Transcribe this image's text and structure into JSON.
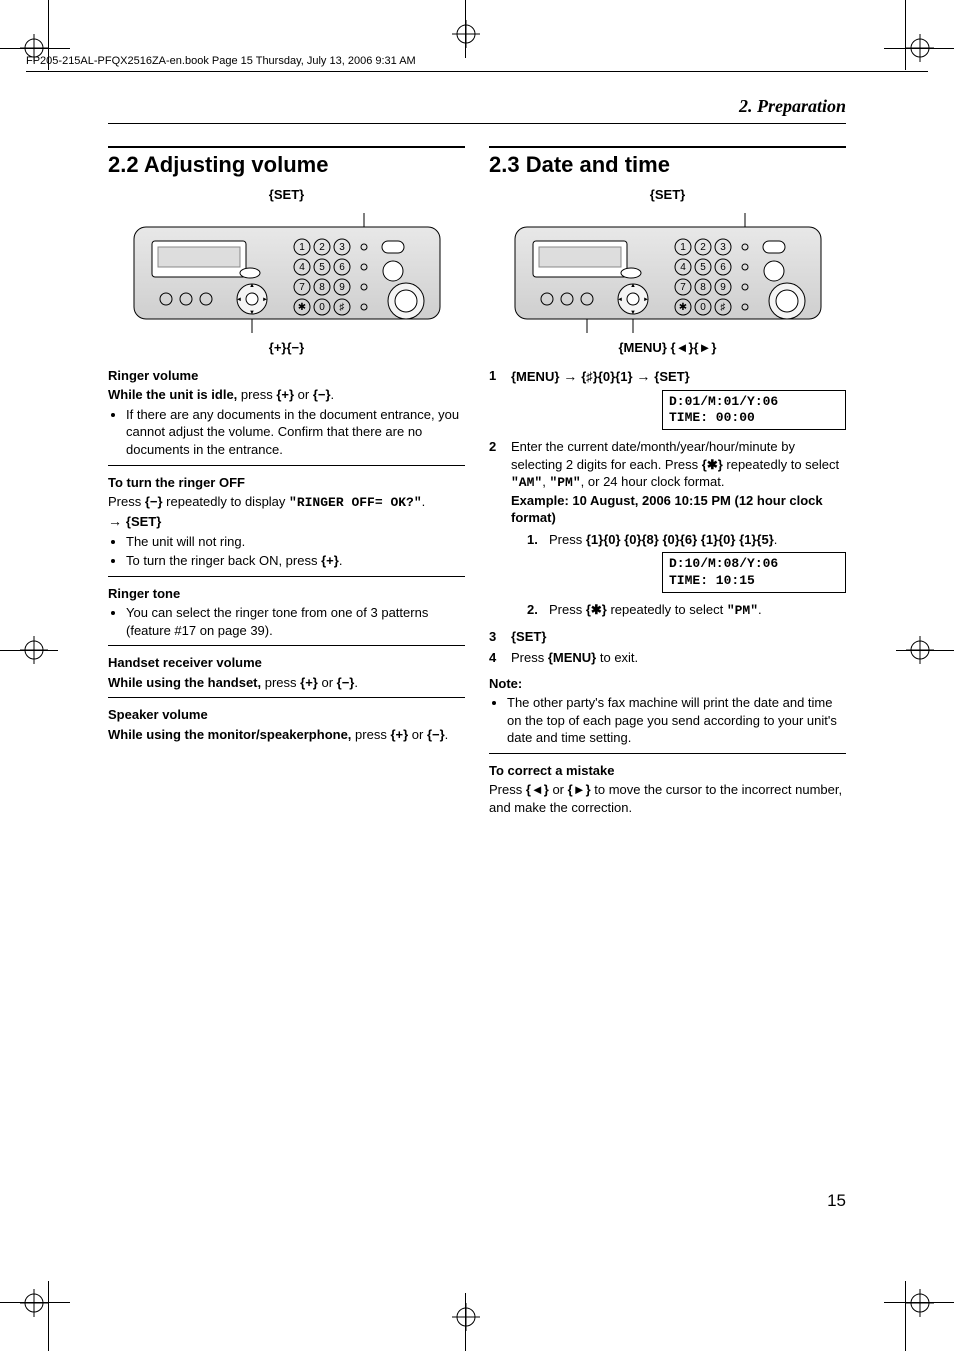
{
  "headerLine": "FP205-215AL-PFQX2516ZA-en.book  Page 15  Thursday, July 13, 2006  9:31 AM",
  "chapterTitle": "2. Preparation",
  "pageNumber": "15",
  "left": {
    "heading": "2.2 Adjusting volume",
    "deviceTop": "{SET}",
    "deviceBottom": "{+}{−}",
    "ringerVol": {
      "title": "Ringer volume",
      "lead1": "While the unit is idle,",
      "lead2": " press ",
      "k1": "{+}",
      "or": " or ",
      "k2": "{−}",
      "tail": ".",
      "b1": "If there are any documents in the document entrance, you cannot adjust the volume. Confirm that there are no documents in the entrance."
    },
    "ringerOff": {
      "title": "To turn the ringer OFF",
      "p1a": "Press ",
      "k1": "{−}",
      "p1b": " repeatedly to display ",
      "code": "\"RINGER OFF= OK?\"",
      "p1c": ". ",
      "arrow": "→ ",
      "k2": "{SET}",
      "b1": "The unit will not ring.",
      "b2a": "To turn the ringer back ON, press ",
      "b2k": "{+}",
      "b2b": "."
    },
    "ringerTone": {
      "title": "Ringer tone",
      "b1": "You can select the ringer tone from one of 3 patterns (feature #17 on page 39)."
    },
    "handset": {
      "title": "Handset receiver volume",
      "lead1": "While using the handset,",
      "lead2": " press ",
      "k1": "{+}",
      "or": " or ",
      "k2": "{−}",
      "tail": "."
    },
    "speaker": {
      "title": "Speaker volume",
      "lead1": "While using the monitor/speakerphone,",
      "lead2": " press ",
      "k1": "{+}",
      "or": " or ",
      "k2": "{−}",
      "tail": "."
    }
  },
  "right": {
    "heading": "2.3 Date and time",
    "deviceTop": "{SET}",
    "deviceBottomL": "{MENU}",
    "deviceBottomSpacer": "   ",
    "deviceBottomR": "{◄}{►}",
    "step1": {
      "n": "1",
      "k1": "{MENU}",
      "arrow": " → ",
      "k2": "{♯}{0}{1}",
      "arrow2": " → ",
      "k3": "{SET}",
      "lcd1": "D:01/M:01/Y:06",
      "lcd2": "TIME: 00:00"
    },
    "step2": {
      "n": "2",
      "p1a": "Enter the current date/month/year/hour/minute by selecting 2 digits for each. Press ",
      "k1": "{✱}",
      "p1b": " repeatedly to select ",
      "am": "\"AM\"",
      "comma": ", ",
      "pm": "\"PM\"",
      "p1c": ", or 24 hour clock format.",
      "ex": "Example: 10 August, 2006 10:15 PM (12 hour clock format)",
      "s1": {
        "n": "1.",
        "p": "Press ",
        "k": "{1}{0} {0}{8} {0}{6} {1}{0} {1}{5}",
        "t": ".",
        "lcd1": "D:10/M:08/Y:06",
        "lcd2": "TIME: 10:15"
      },
      "s2": {
        "n": "2.",
        "p": "Press ",
        "k": "{✱}",
        "p2": " repeatedly to select ",
        "pm": "\"PM\"",
        "t": "."
      }
    },
    "step3": {
      "n": "3",
      "k": "{SET}"
    },
    "step4": {
      "n": "4",
      "p1": "Press ",
      "k": "{MENU}",
      "p2": " to exit."
    },
    "note": {
      "title": "Note:",
      "b1": "The other party's fax machine will print the date and time on the top of each page you send according to your unit's date and time setting."
    },
    "correct": {
      "title": "To correct a mistake",
      "p1": "Press ",
      "k1": "{◄}",
      "or": " or ",
      "k2": "{►}",
      "p2": " to move the cursor to the incorrect number, and make the correction."
    }
  }
}
